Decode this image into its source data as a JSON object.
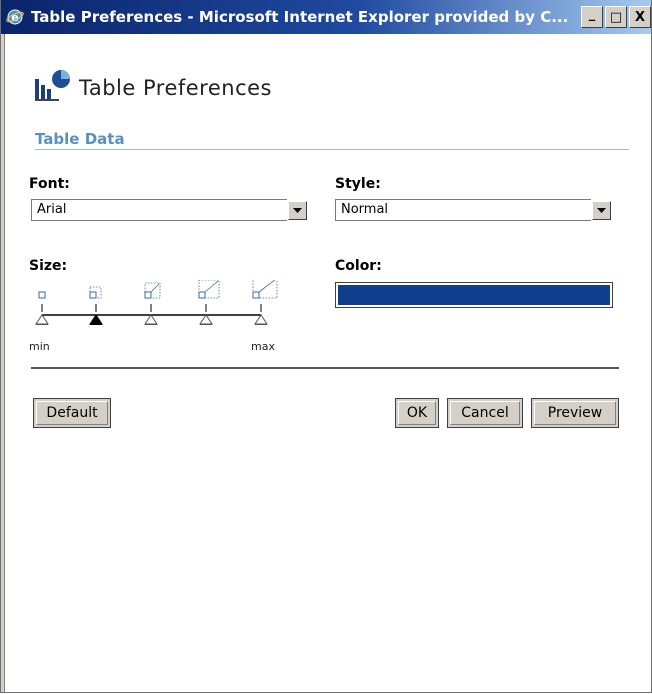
{
  "window": {
    "title": "Table Preferences - Microsoft Internet Explorer provided by C...",
    "minimize_glyph": "_",
    "maximize_glyph": "□",
    "close_glyph": "X"
  },
  "header": {
    "title": "Table Preferences",
    "icon": "chart-icon"
  },
  "section": {
    "title": "Table Data"
  },
  "font": {
    "label": "Font:",
    "value": "Arial"
  },
  "style": {
    "label": "Style:",
    "value": "Normal"
  },
  "size": {
    "label": "Size:",
    "min_label": "min",
    "max_label": "max",
    "levels": 5,
    "selected_index": 1
  },
  "color": {
    "label": "Color:",
    "value": "#0e3f8c"
  },
  "buttons": {
    "default": "Default",
    "ok": "OK",
    "cancel": "Cancel",
    "preview": "Preview"
  },
  "colors": {
    "titlebar_start": "#0a246a",
    "section_title": "#5a90c0",
    "selected_color": "#0e3f8c"
  }
}
